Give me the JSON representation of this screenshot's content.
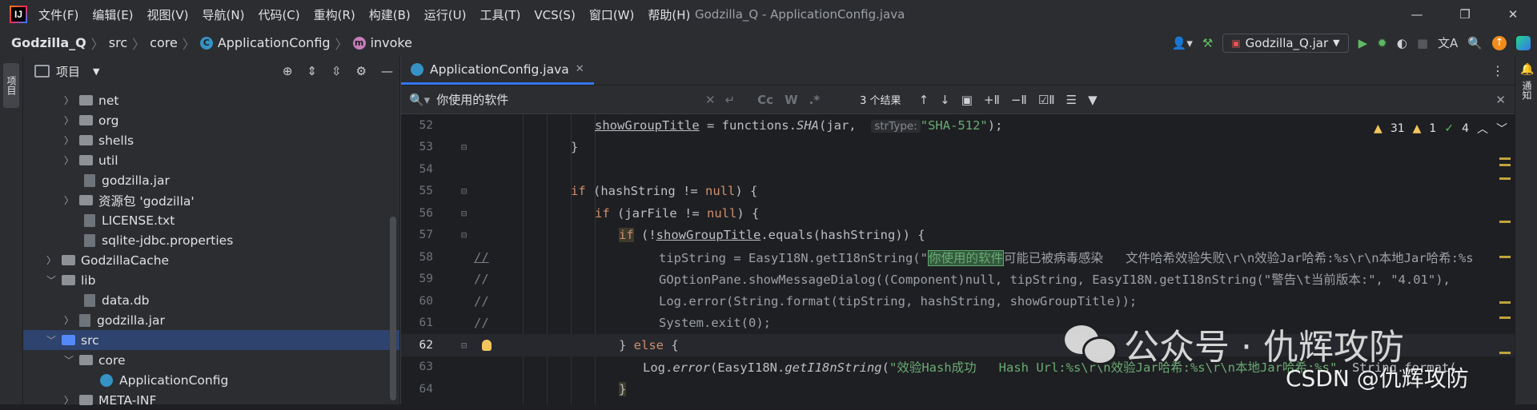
{
  "menubar": {
    "logo_text": "IJ",
    "items": [
      "文件(F)",
      "编辑(E)",
      "视图(V)",
      "导航(N)",
      "代码(C)",
      "重构(R)",
      "构建(B)",
      "运行(U)",
      "工具(T)",
      "VCS(S)",
      "窗口(W)",
      "帮助(H)"
    ],
    "window_title": "Godzilla_Q - ApplicationConfig.java"
  },
  "window_controls": {
    "minimize": "—",
    "restore": "❐",
    "close": "✕"
  },
  "breadcrumb": {
    "project": "Godzilla_Q",
    "src": "src",
    "core": "core",
    "class": "ApplicationConfig",
    "method": "invoke",
    "class_badge": "C",
    "method_badge": "m"
  },
  "toolbar": {
    "run_config": "Godzilla_Q.jar"
  },
  "left_strip": {
    "project_label": "项目"
  },
  "right_strip": {
    "notifications_label": "通知"
  },
  "project_panel": {
    "title": "项目",
    "tree": [
      {
        "label": "net",
        "kind": "folder"
      },
      {
        "label": "org",
        "kind": "folder"
      },
      {
        "label": "shells",
        "kind": "folder"
      },
      {
        "label": "util",
        "kind": "folder"
      },
      {
        "label": "godzilla.jar",
        "kind": "file"
      },
      {
        "label": "资源包 'godzilla'",
        "kind": "folder"
      },
      {
        "label": "LICENSE.txt",
        "kind": "file"
      },
      {
        "label": "sqlite-jdbc.properties",
        "kind": "file"
      },
      {
        "label": "GodzillaCache",
        "kind": "folder"
      },
      {
        "label": "lib",
        "kind": "folder"
      },
      {
        "label": "data.db",
        "kind": "file"
      },
      {
        "label": "godzilla.jar",
        "kind": "file"
      },
      {
        "label": "src",
        "kind": "folder",
        "selected": true
      },
      {
        "label": "core",
        "kind": "folder"
      },
      {
        "label": "ApplicationConfig",
        "kind": "class"
      },
      {
        "label": "META-INF",
        "kind": "folder"
      }
    ]
  },
  "editor": {
    "tab_label": "ApplicationConfig.java",
    "search": {
      "query": "你使用的软件",
      "opt_case": "Cc",
      "opt_word": "W",
      "opt_regex": ".*",
      "result_count": "3 个结果"
    },
    "inspections": {
      "warnings": "31",
      "weak_warnings": "1",
      "typos": "4"
    },
    "lines": [
      "52",
      "53",
      "54",
      "55",
      "56",
      "57",
      "58",
      "59",
      "60",
      "61",
      "62",
      "63",
      "64"
    ]
  },
  "code": {
    "l52a": "showGroupTitle",
    "l52b": " = functions.",
    "l52c": "SHA",
    "l52d": "(jar, ",
    "l52hint": "strType:",
    "l52str": "\"SHA-512\"",
    "l52e": ");",
    "l53": "}",
    "l55kw": "if",
    "l55a": " (hashString != ",
    "l55null": "null",
    "l55b": ") {",
    "l56kw": "if",
    "l56a": " (jarFile != ",
    "l56null": "null",
    "l56b": ") {",
    "l57kw": "if",
    "l57a": " (!",
    "l57u": "showGroupTitle",
    "l57b": ".equals(hashString)) {",
    "l58a": "tipString = EasyI18N.getI18nString(\"",
    "l58m": "你使用的软件",
    "l58b": "可能已被病毒感染   文件哈希效验失败\\r\\n效验Jar哈希:%s\\r\\n本地Jar哈希:%s",
    "l59a": "GOptionPane.showMessageDialog((Component)null, tipString, EasyI18N.getI18nString(\"警告\\t当前版本:\", \"4.01\"),",
    "l60a": "Log.error(String.format(tipString, hashString, showGroupTitle));",
    "l61a": "System.exit(0);",
    "l62a": "} ",
    "l62kw": "else",
    "l62b": " {",
    "l63a": "Log.",
    "l63b": "error",
    "l63c": "(EasyI18N.",
    "l63d": "getI18nString",
    "l63e": "(",
    "l63str": "\"效验Hash成功   Hash Url:%s\\r\\n效验Jar哈希:%s\\r\\n本地Jar哈希:%s\"",
    "l63f": ", String.format(",
    "l64": "}",
    "comment": "//"
  },
  "watermark": {
    "text": "公众号 · 仇辉攻防",
    "csdn": "CSDN @仇辉攻防"
  },
  "colors": {
    "accent": "#3574f0",
    "keyword": "#cf8e6d",
    "string": "#6aab73",
    "method": "#56a8f5",
    "background": "#1e1f22"
  }
}
